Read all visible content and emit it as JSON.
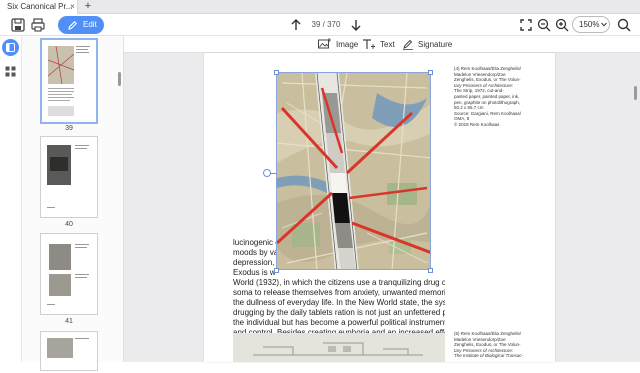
{
  "tab": {
    "title": "Six Canonical Pr...",
    "close_glyph": "×",
    "new_glyph": "+"
  },
  "toolbar": {
    "edit_label": "Edit",
    "page_current": "39",
    "page_total": "370",
    "zoom_value": "150%"
  },
  "edit_tools": {
    "image_label": "Image",
    "text_label": "Text",
    "signature_label": "Signature"
  },
  "thumbnails": [
    {
      "number": "39",
      "selected": true
    },
    {
      "number": "40",
      "selected": false
    },
    {
      "number": "41",
      "selected": false
    }
  ],
  "document": {
    "body_lines": [
      "lucinogenic e                                                     their",
      "moods by var                                                      evo-",
      "depression, d",
      "      Exodus is                                                  w",
      "World (1932), in which the citizens use a tranquilizing drug called",
      "soma to release themselves from anxiety, unwanted memories, and",
      "the dullness of everyday life. In the New World state, the systematic",
      "drugging by the daily tablets ration is not just an unfettered privilege of",
      "the individual but has become a powerful political instrument of rule",
      "and control. Besides creating euphoria and an increased effectiveness"
    ],
    "caption_1": [
      "(4) Rem Koolhaas/Elia Zenghelis/",
      "Madelon Vriesendorp/Zoe",
      "Zenghelis, Exodus, or The Volun-",
      "tary Prisoners of Architecture:",
      "The Strip, 1972, cut-and-",
      "pasted paper, painted paper, ink,",
      "pen, graphite on photolithograph,",
      "50.2 x 65.7 cm",
      "Source: Gargiani, Rem Koolhaas/",
      "OMA, 8",
      "© 2018 Rem Koolhaas"
    ],
    "caption_2": [
      "(5) Rem Koolhaas/Elia Zenghelis/",
      "Madelon Vriesendorp/Zoe",
      "Zenghelis, Exodus, or The Volun-",
      "tary Prisoners of Architecture:",
      "The Institute of Biological Transac-"
    ]
  },
  "colors": {
    "accent": "#4f8ff7",
    "map_line": "#d9362b"
  }
}
